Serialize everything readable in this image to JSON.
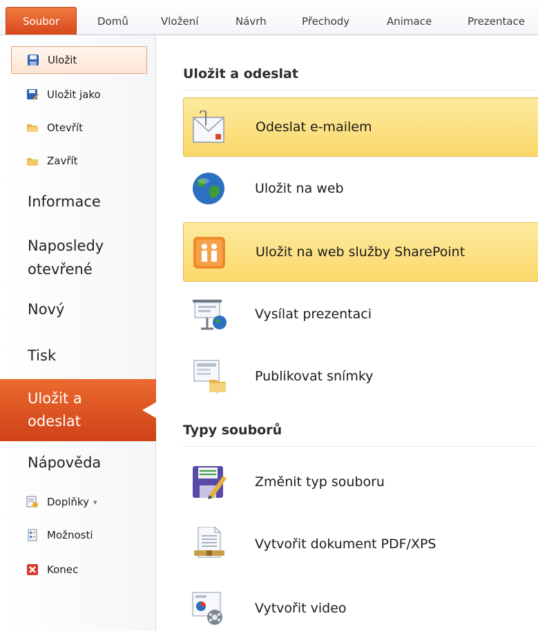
{
  "ribbon": {
    "tabs": [
      {
        "label": "Soubor"
      },
      {
        "label": "Domů"
      },
      {
        "label": "Vložení"
      },
      {
        "label": "Návrh"
      },
      {
        "label": "Přechody"
      },
      {
        "label": "Animace"
      },
      {
        "label": "Prezentace"
      }
    ]
  },
  "nav": {
    "small_items": [
      {
        "label": "Uložit",
        "icon": "save-icon"
      },
      {
        "label": "Uložit jako",
        "icon": "save-as-icon"
      },
      {
        "label": "Otevřít",
        "icon": "open-folder-icon"
      },
      {
        "label": "Zavřít",
        "icon": "close-folder-icon"
      }
    ],
    "big_items": [
      {
        "label": "Informace"
      },
      {
        "label": "Naposledy\notevřené"
      },
      {
        "label": "Nový"
      },
      {
        "label": "Tisk"
      },
      {
        "label": "Uložit a\nodeslat"
      },
      {
        "label": "Nápověda"
      }
    ],
    "bottom_items": [
      {
        "label": "Doplňky",
        "icon": "addins-icon",
        "dropdown": "▾"
      },
      {
        "label": "Možnosti",
        "icon": "options-icon"
      },
      {
        "label": "Konec",
        "icon": "exit-icon"
      }
    ]
  },
  "main": {
    "save_send": {
      "title": "Uložit a odeslat",
      "items": [
        {
          "label": "Odeslat e-mailem",
          "icon": "email-icon"
        },
        {
          "label": "Uložit na web",
          "icon": "globe-icon"
        },
        {
          "label": "Uložit na web služby SharePoint",
          "icon": "sharepoint-icon"
        },
        {
          "label": "Vysílat prezentaci",
          "icon": "broadcast-icon"
        },
        {
          "label": "Publikovat snímky",
          "icon": "publish-slides-icon"
        }
      ]
    },
    "file_types": {
      "title": "Typy souborů",
      "items": [
        {
          "label": "Změnit typ souboru",
          "icon": "change-file-type-icon"
        },
        {
          "label": "Vytvořit dokument PDF/XPS",
          "icon": "pdf-xps-icon"
        },
        {
          "label": "Vytvořit video",
          "icon": "video-icon"
        }
      ]
    }
  },
  "colors": {
    "accent": "#d8481c",
    "highlight": "#fbd86a"
  }
}
